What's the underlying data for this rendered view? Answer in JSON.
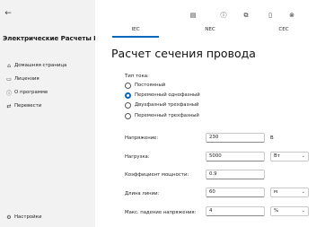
{
  "sidebar": {
    "back_glyph": "←",
    "app_title": "Электрические Расчеты PRO",
    "items": [
      {
        "icon": "home-icon",
        "glyph": "⌂",
        "label": "Домашняя страница"
      },
      {
        "icon": "license-icon",
        "glyph": "▭",
        "label": "Лицензия"
      },
      {
        "icon": "info-icon",
        "glyph": "ⓘ",
        "label": "О программе"
      },
      {
        "icon": "translate-icon",
        "glyph": "⇄",
        "label": "Перевести"
      }
    ],
    "settings": {
      "icon": "gear-icon",
      "glyph": "⚙",
      "label": "Настройки"
    }
  },
  "toolbar": {
    "icons": [
      {
        "name": "print-icon",
        "glyph": "▤"
      },
      {
        "name": "info-icon",
        "glyph": "ⓘ"
      },
      {
        "name": "share-icon",
        "glyph": "⧉"
      },
      {
        "name": "tablet-icon",
        "glyph": "▯"
      },
      {
        "name": "close-icon",
        "glyph": "⊗"
      }
    ]
  },
  "tabs": [
    {
      "label": "IEC",
      "selected": true
    },
    {
      "label": "NEC",
      "selected": false
    },
    {
      "label": "CEC",
      "selected": false
    }
  ],
  "page": {
    "title": "Расчет сечения провода",
    "current_type_label": "Тип тока:",
    "current_types": [
      {
        "label": "Постоянный",
        "selected": false
      },
      {
        "label": "Переменный однофазный",
        "selected": true
      },
      {
        "label": "Двухфазный трехфазный",
        "selected": false
      },
      {
        "label": "Переменный трехфазный",
        "selected": false
      }
    ],
    "fields": {
      "voltage": {
        "label": "Напряжение:",
        "value": "230",
        "unit": "В"
      },
      "load": {
        "label": "Нагрузка:",
        "value": "5000",
        "unit": "Вт"
      },
      "power_factor": {
        "label": "Коэффициент мощности:",
        "value": "0.9"
      },
      "line_length": {
        "label": "Длина линии:",
        "value": "60",
        "unit": "м"
      },
      "max_voltage_drop": {
        "label": "Макс. падение напряжения:",
        "value": "4",
        "unit": "%"
      }
    }
  },
  "colors": {
    "accent": "#0067c0",
    "sidebar_bg": "#f2f2f2",
    "content_bg": "#ffffff"
  }
}
